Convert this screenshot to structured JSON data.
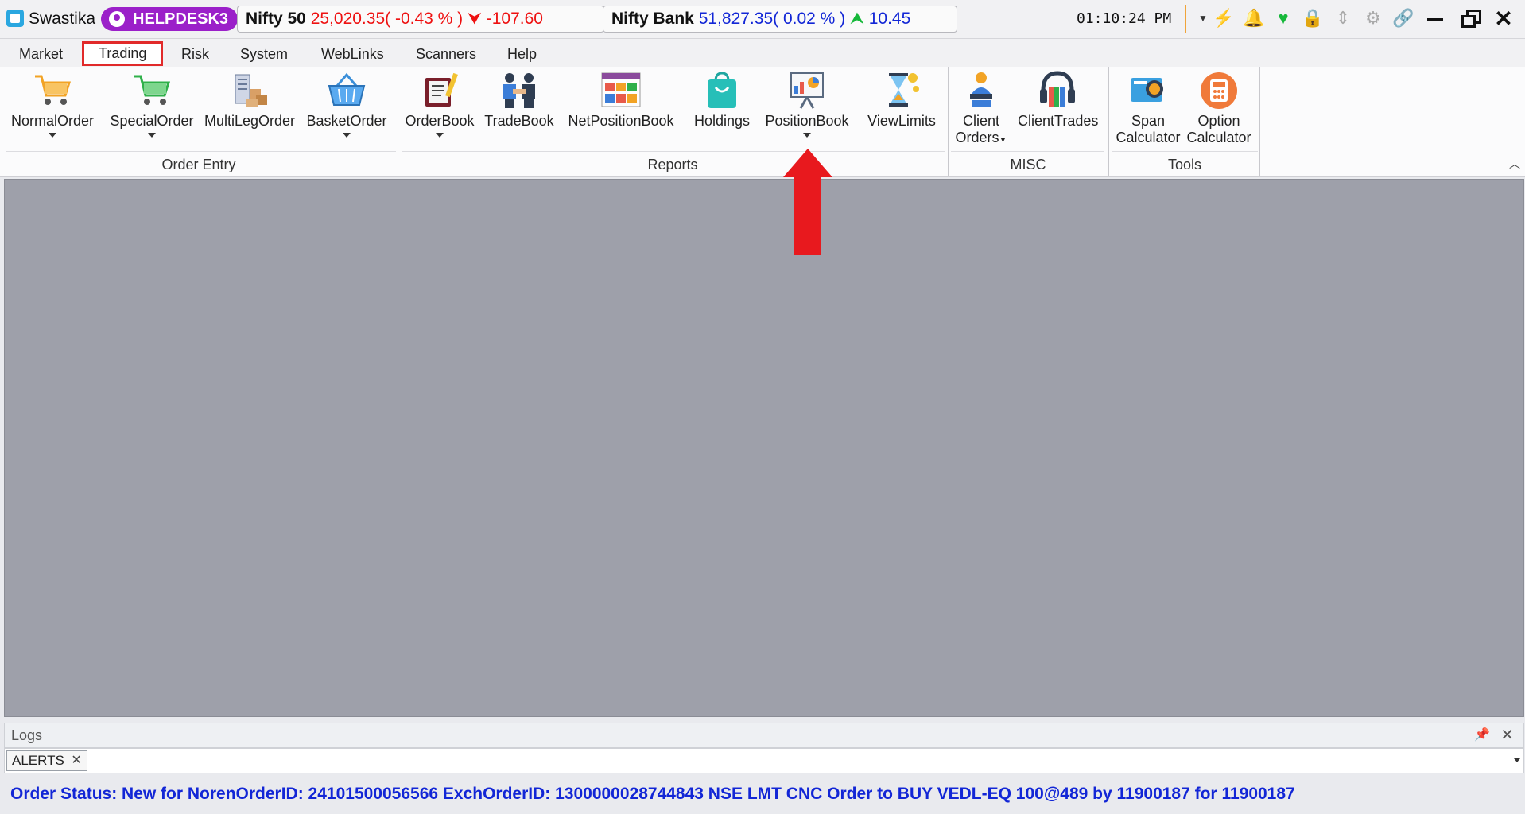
{
  "app": {
    "name": "Swastika",
    "user_badge": "HELPDESK3"
  },
  "tickers": [
    {
      "name": "Nifty 50",
      "value": "25,020.35",
      "pct": "( -0.43 % )",
      "change": "-107.60",
      "direction": "down"
    },
    {
      "name": "Nifty Bank",
      "value": "51,827.35",
      "pct": "( 0.02 % )",
      "change": "10.45",
      "direction": "up"
    }
  ],
  "clock": "01:10:24 PM",
  "toolbar_icons": [
    "dropdown-icon",
    "magic-wand-icon",
    "bell-icon",
    "heartbeat-icon",
    "lock-icon",
    "resize-icon",
    "gear-icon",
    "link-icon",
    "minimize-icon",
    "restore-icon",
    "close-icon"
  ],
  "menu": {
    "tabs": [
      "Market",
      "Trading",
      "Risk",
      "System",
      "WebLinks",
      "Scanners",
      "Help"
    ],
    "active": "Trading"
  },
  "ribbon": {
    "order_entry": {
      "label": "Order Entry",
      "buttons": [
        "NormalOrder",
        "SpecialOrder",
        "MultiLegOrder",
        "BasketOrder"
      ]
    },
    "reports": {
      "label": "Reports",
      "buttons": [
        "OrderBook",
        "TradeBook",
        "NetPositionBook",
        "Holdings",
        "PositionBook",
        "ViewLimits"
      ]
    },
    "misc": {
      "label": "MISC",
      "buttons": [
        [
          "Client",
          "Orders"
        ],
        "ClientTrades"
      ]
    },
    "tools": {
      "label": "Tools",
      "buttons": [
        [
          "Span",
          "Calculator"
        ],
        [
          "Option",
          "Calculator"
        ]
      ]
    }
  },
  "logs": {
    "title": "Logs",
    "tab": "ALERTS"
  },
  "status": "Order Status: New for NorenOrderID: 24101500056566  ExchOrderID: 1300000028744843  NSE  LMT  CNC  Order to BUY  VEDL-EQ  100@489  by 11900187  for 11900187",
  "colors": {
    "accent_purple": "#9b20c9",
    "down": "#e11111",
    "up_value": "#1226d6",
    "up_arrow": "#16b83a",
    "highlight": "#e12a2a"
  }
}
